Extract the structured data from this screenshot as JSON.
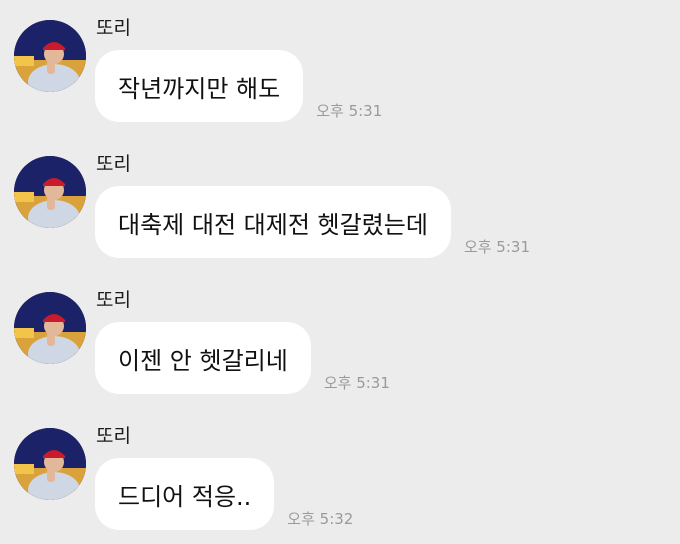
{
  "chat": {
    "messages": [
      {
        "sender": "또리",
        "text": "작년까지만 해도",
        "time": "오후 5:31",
        "avatar_icon": "profile-photo"
      },
      {
        "sender": "또리",
        "text": "대축제 대전 대제전 헷갈렸는데",
        "time": "오후 5:31",
        "avatar_icon": "profile-photo"
      },
      {
        "sender": "또리",
        "text": "이젠 안 헷갈리네",
        "time": "오후 5:31",
        "avatar_icon": "profile-photo"
      },
      {
        "sender": "또리",
        "text": "드디어 적응..",
        "time": "오후 5:32",
        "avatar_icon": "profile-photo"
      }
    ]
  },
  "colors": {
    "background": "#ececec",
    "bubble": "#ffffff",
    "time_text": "#9a9a9a"
  }
}
